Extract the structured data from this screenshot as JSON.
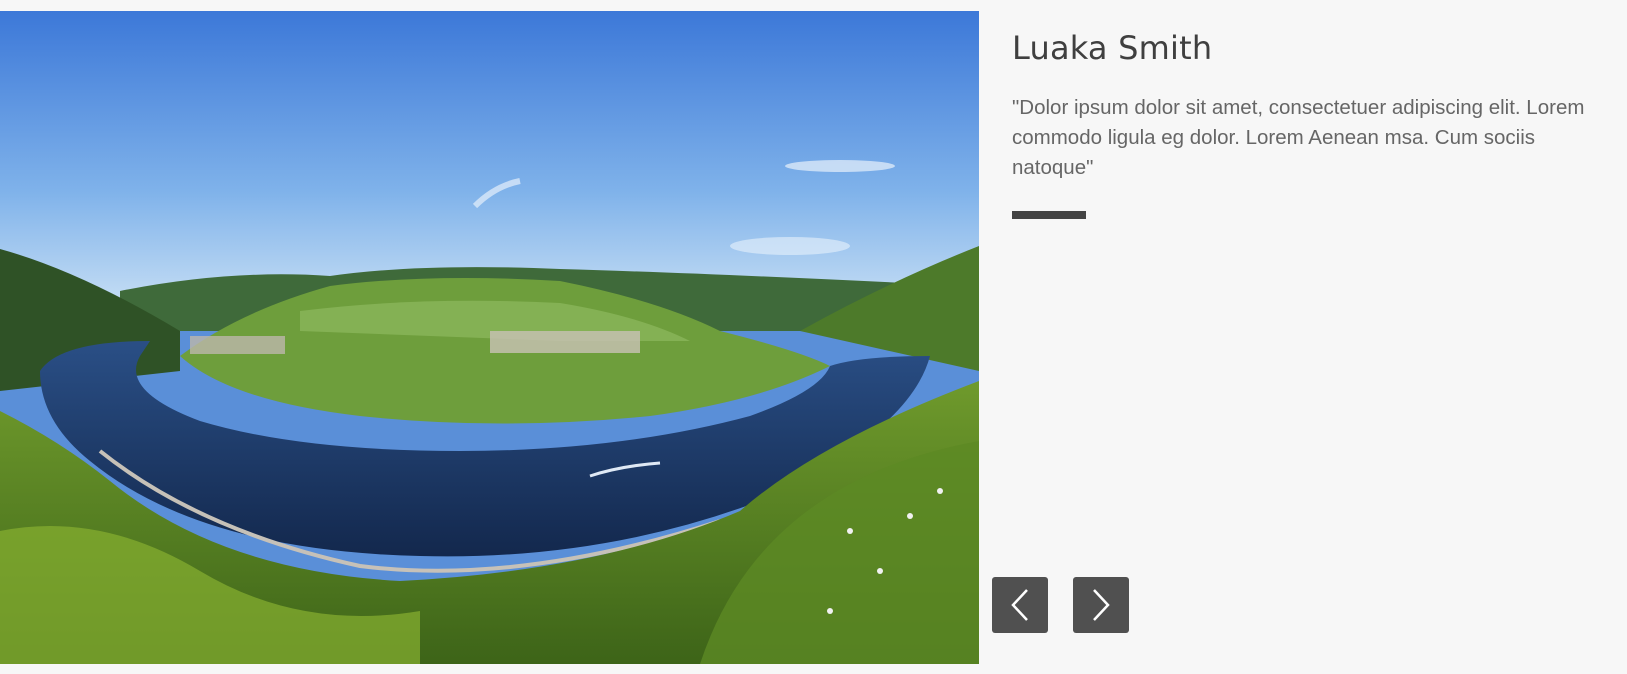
{
  "testimonial": {
    "name": "Luaka Smith",
    "quote": "\"Dolor ipsum dolor sit amet, consectetuer adipiscing elit. Lorem commodo ligula eg dolor. Lorem Aenean msa. Cum sociis natoque\""
  },
  "navigation": {
    "prev_icon": "chevron-left-icon",
    "next_icon": "chevron-right-icon"
  },
  "colors": {
    "background": "#f7f7f7",
    "name_text": "#3f3f3f",
    "quote_text": "#666666",
    "divider": "#444444",
    "nav_button": "#505050",
    "nav_icon": "#ffffff"
  }
}
